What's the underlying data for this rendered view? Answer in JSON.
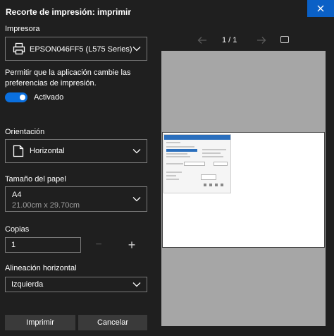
{
  "window": {
    "title": "Recorte de impresión: imprimir"
  },
  "printer": {
    "label": "Impresora",
    "selected": "EPSON046FF5 (L575 Series)"
  },
  "app_prefs": {
    "label_line1": "Permitir que la aplicación cambie las",
    "label_line2": "preferencias de impresión.",
    "toggle_state": "Activado"
  },
  "orientation": {
    "label": "Orientación",
    "selected": "Horizontal"
  },
  "paper_size": {
    "label": "Tamaño del papel",
    "selected": "A4",
    "dimensions": "21.00cm x 29.70cm"
  },
  "copies": {
    "label": "Copias",
    "value": "1",
    "minus": "−",
    "plus": "+"
  },
  "alignment": {
    "label": "Alineación horizontal",
    "selected": "Izquierda"
  },
  "buttons": {
    "print": "Imprimir",
    "cancel": "Cancelar"
  },
  "preview": {
    "page_indicator": "1 / 1"
  },
  "colors": {
    "accent": "#0a6fde",
    "background": "#1f1f1f",
    "preview_bg": "#a6a6a6"
  }
}
